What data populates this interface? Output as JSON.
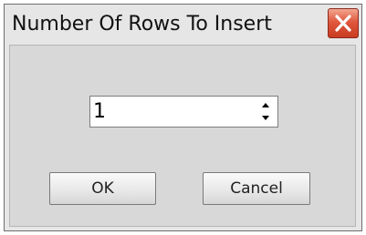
{
  "dialog": {
    "title": "Number Of Rows To Insert",
    "close_icon": "close-x-icon",
    "close_color": "#d9533a"
  },
  "spinner": {
    "value": "1",
    "up_icon": "spin-up-arrow-icon",
    "down_icon": "spin-down-arrow-icon"
  },
  "buttons": {
    "ok_label": "OK",
    "cancel_label": "Cancel"
  }
}
